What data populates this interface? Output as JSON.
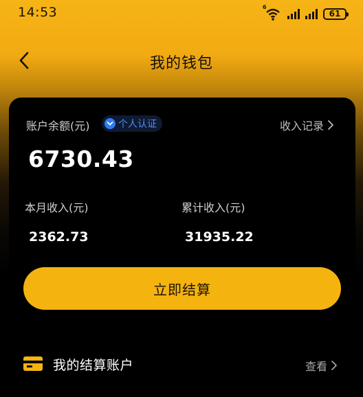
{
  "status_bar": {
    "time": "14:53",
    "network_tag": "6",
    "battery": "61"
  },
  "nav": {
    "title": "我的钱包",
    "back_icon": "chevron-left-icon"
  },
  "wallet": {
    "balance_label": "账户余额(元)",
    "verify_badge": "个人认证",
    "income_record_label": "收入记录",
    "balance": "6730.43",
    "month_income_label": "本月收入(元)",
    "month_income": "2362.73",
    "total_income_label": "累计收入(元)",
    "total_income": "31935.22",
    "settle_button": "立即结算"
  },
  "account": {
    "title": "我的结算账户",
    "view_label": "查看",
    "icon": "card-icon"
  },
  "colors": {
    "accent": "#f5b310",
    "verify_blue": "#2f7bf2"
  }
}
